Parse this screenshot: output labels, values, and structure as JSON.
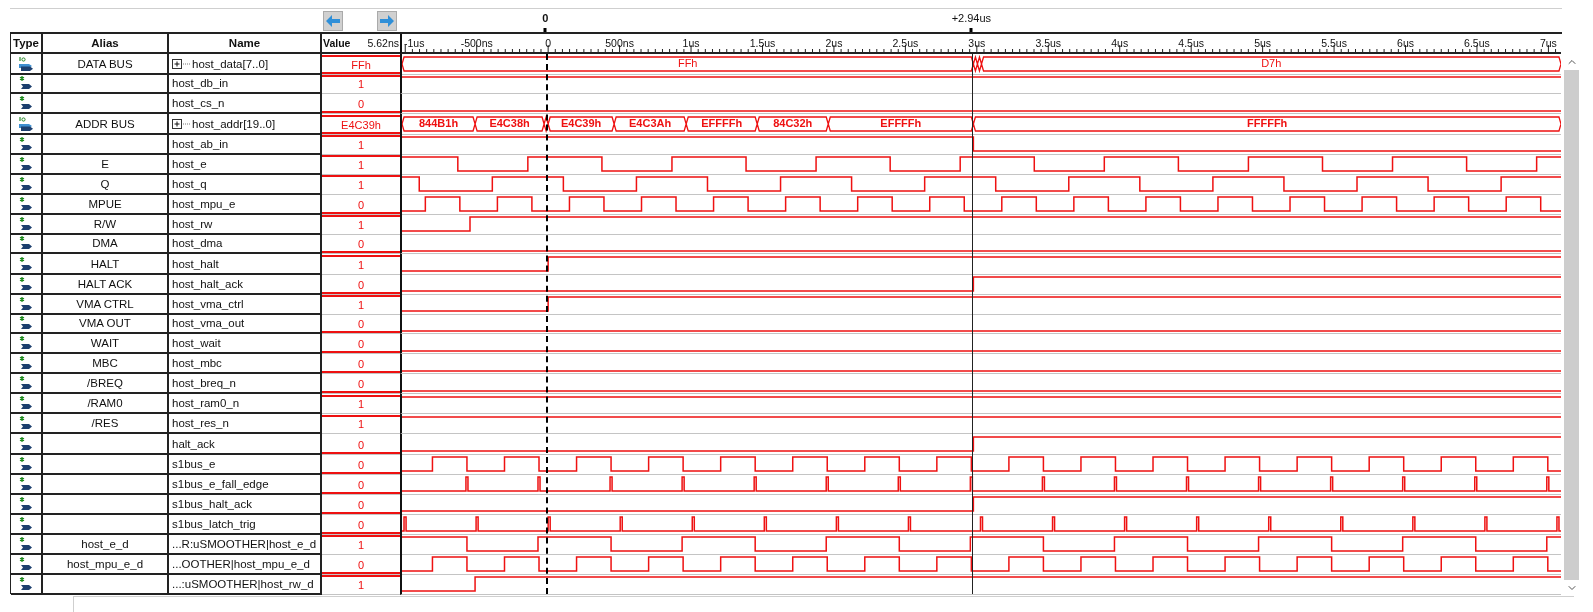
{
  "cursors": [
    {
      "label": "0"
    },
    {
      "label": "+2.94us"
    }
  ],
  "columns": {
    "type": "Type",
    "alias": "Alias",
    "name": "Name",
    "value": "Value",
    "value_time": "5.62ns"
  },
  "time_ruler": [
    "-1us",
    "-500ns",
    "0",
    "500ns",
    "1us",
    "1.5us",
    "2us",
    "2.5us",
    "3us",
    "3.5us",
    "4us",
    "4.5us",
    "5us",
    "5.5us",
    "6us",
    "6.5us",
    "7us"
  ],
  "signals": [
    {
      "kind": "bus",
      "alias": "DATA BUS",
      "name": "host_data[7..0]",
      "value": "FFh",
      "segments": [
        "FFh",
        "D7h"
      ]
    },
    {
      "kind": "bit",
      "name": "host_db_in",
      "value": "1",
      "high": true
    },
    {
      "kind": "bit",
      "name": "host_cs_n",
      "value": "0",
      "high": false
    },
    {
      "kind": "bus",
      "alias": "ADDR BUS",
      "name": "host_addr[19..0]",
      "value": "E4C39h",
      "segments": [
        "844B1h",
        "E4C38h",
        "E4C39h",
        "E4C3Ah",
        "EFFFFh",
        "84C32h",
        "EFFFFh",
        "FFFFFh"
      ]
    },
    {
      "kind": "bit",
      "name": "host_ab_in",
      "value": "1",
      "high": true
    },
    {
      "kind": "bit",
      "alias": "E",
      "name": "host_e",
      "value": "1",
      "high": true
    },
    {
      "kind": "bit",
      "alias": "Q",
      "name": "host_q",
      "value": "1",
      "high": true
    },
    {
      "kind": "bit",
      "alias": "MPUE",
      "name": "host_mpu_e",
      "value": "0",
      "high": false
    },
    {
      "kind": "bit",
      "alias": "R/W",
      "name": "host_rw",
      "value": "1",
      "high": true
    },
    {
      "kind": "bit",
      "alias": "DMA",
      "name": "host_dma",
      "value": "0",
      "high": false
    },
    {
      "kind": "bit",
      "alias": "HALT",
      "name": "host_halt",
      "value": "1",
      "high": true
    },
    {
      "kind": "bit",
      "alias": "HALT ACK",
      "name": "host_halt_ack",
      "value": "0",
      "high": false
    },
    {
      "kind": "bit",
      "alias": "VMA CTRL",
      "name": "host_vma_ctrl",
      "value": "1",
      "high": true
    },
    {
      "kind": "bit",
      "alias": "VMA OUT",
      "name": "host_vma_out",
      "value": "0",
      "high": false
    },
    {
      "kind": "bit",
      "alias": "WAIT",
      "name": "host_wait",
      "value": "0",
      "high": false
    },
    {
      "kind": "bit",
      "alias": "MBC",
      "name": "host_mbc",
      "value": "0",
      "high": false
    },
    {
      "kind": "bit",
      "alias": "/BREQ",
      "name": "host_breq_n",
      "value": "0",
      "high": false
    },
    {
      "kind": "bit",
      "alias": "/RAM0",
      "name": "host_ram0_n",
      "value": "1",
      "high": true
    },
    {
      "kind": "bit",
      "alias": "/RES",
      "name": "host_res_n",
      "value": "1",
      "high": true
    },
    {
      "kind": "bit",
      "name": "halt_ack",
      "value": "0",
      "high": false
    },
    {
      "kind": "bit",
      "name": "s1bus_e",
      "value": "0",
      "high": false
    },
    {
      "kind": "bit",
      "name": "s1bus_e_fall_edge",
      "value": "0",
      "high": false
    },
    {
      "kind": "bit",
      "name": "s1bus_halt_ack",
      "value": "0",
      "high": false
    },
    {
      "kind": "bit",
      "name": "s1bus_latch_trig",
      "value": "0",
      "high": false
    },
    {
      "kind": "bit",
      "alias": "host_e_d",
      "name": "...R:uSMOOTHER|host_e_d",
      "value": "1",
      "high": true
    },
    {
      "kind": "bit",
      "alias": "host_mpu_e_d",
      "name": "...OOTHER|host_mpu_e_d",
      "value": "0",
      "high": false
    },
    {
      "kind": "bit",
      "name": "...:uSMOOTHER|host_rw_d",
      "value": "1",
      "high": true
    }
  ]
}
